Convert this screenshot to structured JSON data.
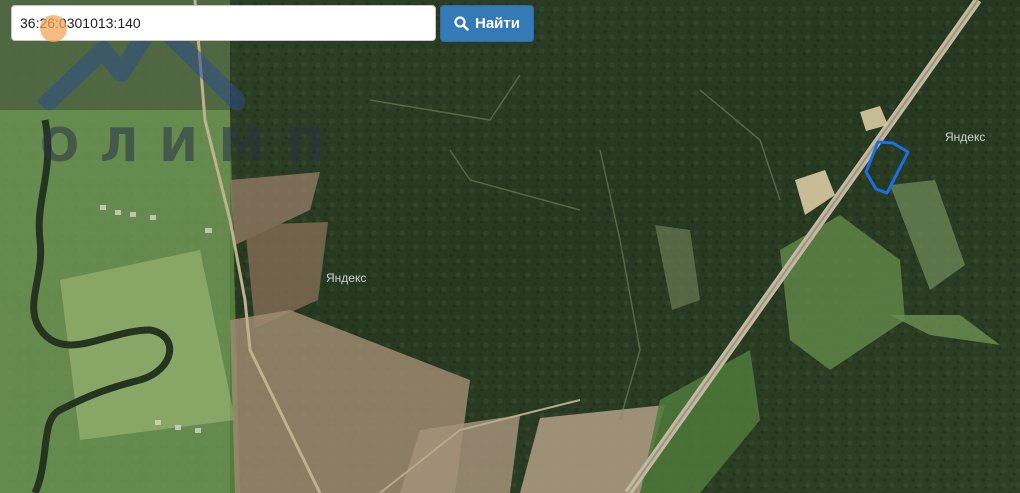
{
  "search": {
    "value": "36:26:0301013:140",
    "button_label": "Найти",
    "button_icon": "search-icon"
  },
  "watermark": {
    "text": "ОЛИМП",
    "icon": "mountain-logo"
  },
  "map": {
    "labels": [
      "Яндекс",
      "Яндекс"
    ],
    "parcel_color": "#1a6fe8",
    "accent": "#337ab7"
  }
}
